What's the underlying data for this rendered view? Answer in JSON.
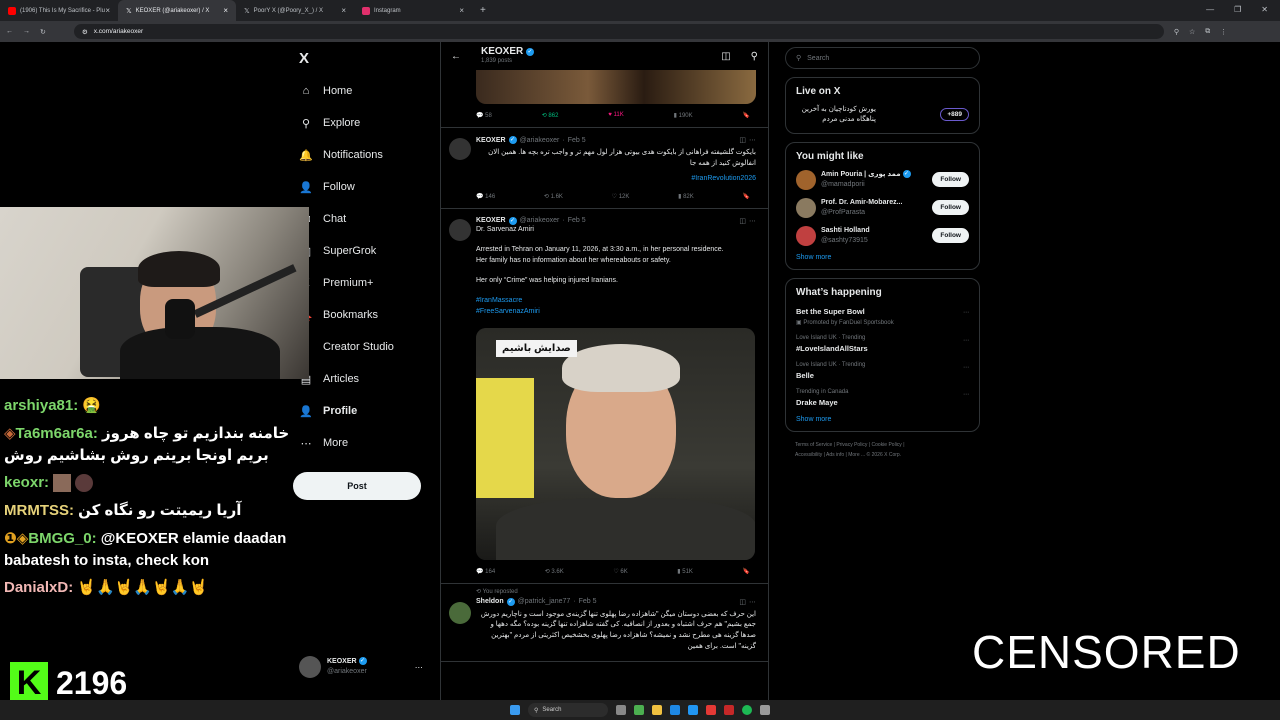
{
  "browser": {
    "tabs": [
      {
        "label": "(1906) This Is My Sacrifice - Plu",
        "color": "#ff0000"
      },
      {
        "label": "KEOXER (@ariakeoxer) / X",
        "color": "#ffffff"
      },
      {
        "label": "PoorY X (@Poory_X_) / X",
        "color": "#ffffff"
      },
      {
        "label": "Instagram",
        "color": "#e1306c"
      }
    ],
    "url": "x.com/ariakeoxer"
  },
  "x_nav": {
    "logo": "X",
    "items": [
      {
        "label": "Home",
        "icon": "home-icon",
        "glyph": "⌂"
      },
      {
        "label": "Explore",
        "icon": "search-icon",
        "glyph": "⚲"
      },
      {
        "label": "Notifications",
        "icon": "bell-icon",
        "glyph": "🔔"
      },
      {
        "label": "Follow",
        "icon": "person-add-icon",
        "glyph": "👤"
      },
      {
        "label": "Chat",
        "icon": "chat-icon",
        "glyph": "✉"
      },
      {
        "label": "SuperGrok",
        "icon": "grok-icon",
        "glyph": "◫"
      },
      {
        "label": "Premium+",
        "icon": "x-premium-icon",
        "glyph": "X"
      },
      {
        "label": "Bookmarks",
        "icon": "bookmark-icon",
        "glyph": "🔖"
      },
      {
        "label": "Creator Studio",
        "icon": "creator-icon",
        "glyph": "⚡"
      },
      {
        "label": "Articles",
        "icon": "articles-icon",
        "glyph": "▤"
      },
      {
        "label": "Profile",
        "icon": "profile-icon",
        "glyph": "👤"
      },
      {
        "label": "More",
        "icon": "more-icon",
        "glyph": "⋯"
      }
    ],
    "post_label": "Post",
    "account": {
      "name": "KEOXER",
      "handle": "@ariakeoxer"
    }
  },
  "profile_header": {
    "name": "KEOXER",
    "posts": "1,839 posts"
  },
  "tweets": [
    {
      "type": "stats_only",
      "replies": "58",
      "reposts": "862",
      "likes": "11K",
      "views": "190K"
    },
    {
      "name": "KEOXER",
      "handle": "@ariakeoxer",
      "date": "Feb 5",
      "text_rtl": "بایکوت گلشیفته فراهانی از بایکوت هدی بیوتی هزار لول مهم تر و واجب تره بچه ها. همین الان انفالوش کنید از همه جا",
      "hashtag": "#IranRevolution2026",
      "replies": "146",
      "reposts": "1.6K",
      "likes": "12K",
      "views": "82K"
    },
    {
      "name": "KEOXER",
      "handle": "@ariakeoxer",
      "date": "Feb 5",
      "title": "Dr. Sarvenaz Amiri",
      "line1": "Arrested in Tehran on January 11, 2026, at 3:30 a.m., in her personal residence.",
      "line2": "Her family has no information about her whereabouts or safety.",
      "line3": "Her only “Crime” was helping injured Iranians.",
      "hashtag1": "#IranMassacre",
      "hashtag2": "#FreeSarvenazAmiri",
      "photo_caption": "صدایش باشیم",
      "replies": "164",
      "reposts": "3.6K",
      "likes": "6K",
      "views": "51K"
    },
    {
      "repost_label": "You reposted",
      "name": "Sheldon",
      "handle": "@patrick_jane77",
      "date": "Feb 5",
      "text_rtl": "این حرف که بعضی دوستان میگن \"شاهزاده رضا پهلوی تنها گزینه‌ی موجود است و ناچاریم دورش جمع بشیم\" هم حرف اشتباه و بعدور از انصافیه. کی گفته شاهزاده تنها گزینه بوده؟ مگه دهها و صدها گزینه هی مطرح نشد و نمیشه؟ شاهزاده رضا پهلوی بخشخیص اکثریتی از مردم \"بهترین گزینه\" است. برای همین"
    }
  ],
  "right": {
    "search_placeholder": "Search",
    "live": {
      "title": "Live on X",
      "text": "یورش کودتاچیان به آخرین پناهگاه مدنی مردم",
      "count": "+889"
    },
    "might_like": {
      "title": "You might like",
      "people": [
        {
          "name": "Amin Pouria | ممد پوری",
          "handle": "@mamadporii",
          "follow": "Follow",
          "color": "#a0632c"
        },
        {
          "name": "Prof. Dr. Amir-Mobarez...",
          "handle": "@ProfParasta",
          "follow": "Follow",
          "color": "#8a7a60"
        },
        {
          "name": "Sashti Holland",
          "handle": "@sashty73915",
          "follow": "Follow",
          "color": "#c04040"
        }
      ],
      "show_more": "Show more"
    },
    "happening": {
      "title": "What’s happening",
      "trends": [
        {
          "meta": "Promoted by FanDuel Sportsbook",
          "name": "Bet the Super Bowl",
          "promoted": true
        },
        {
          "meta": "Love Island UK · Trending",
          "name": "#LoveIslandAllStars"
        },
        {
          "meta": "Love Island UK · Trending",
          "name": "Belle"
        },
        {
          "meta": "Trending in Canada",
          "name": "Drake Maye"
        }
      ],
      "show_more": "Show more"
    },
    "footer": [
      "Terms of Service",
      "Privacy Policy",
      "Cookie Policy",
      "Accessibility",
      "Ads info",
      "More ...",
      "© 2026 X Corp."
    ]
  },
  "chat": [
    {
      "user": "arshiya81:",
      "cls": "uname-g",
      "text": "🤮"
    },
    {
      "user": "Ta6m6ar6a:",
      "cls": "uname-c",
      "text": "خامنه بندازیم تو چاه هروز بریم اونجا برینم روش بشاشیم روش"
    },
    {
      "user": "keoxr:",
      "cls": "uname-g",
      "text": ""
    },
    {
      "user": "MRMTSS:",
      "cls": "uname-y",
      "text": "آریا ریمیتت رو نگاه کن"
    },
    {
      "user": "BMGG_0:",
      "cls": "uname-g",
      "text": "@KEOXER elamie daadan babatesh to insta, check kon"
    },
    {
      "user": "DanialxD:",
      "cls": "uname-p",
      "text": ""
    }
  ],
  "stream": {
    "viewers": "2196",
    "censored": "CENSORED"
  },
  "taskbar": {
    "search": "Search"
  }
}
